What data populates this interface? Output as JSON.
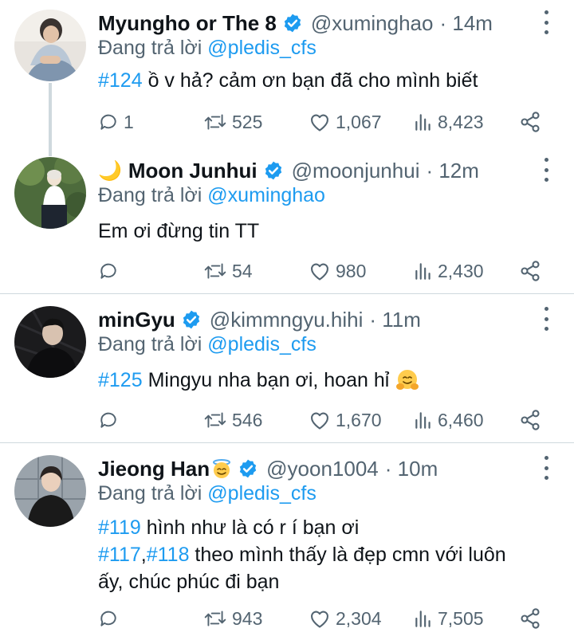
{
  "colors": {
    "accent": "#1d9bf0",
    "secondary_text": "#536471",
    "primary_text": "#0f1419",
    "divider": "#cfd9de"
  },
  "tweets": [
    {
      "name": "Myungho or The 8",
      "name_prefix_emoji": "",
      "name_suffix_emoji": "",
      "handle": "@xuminghao",
      "time": "· 14m",
      "reply_prefix": "Đang trả lời ",
      "reply_to": "@pledis_cfs",
      "lines": [
        {
          "tag": "#124",
          "text": " ồ v hả? cảm ơn bạn đã cho mình biết"
        }
      ],
      "replies": "1",
      "retweets": "525",
      "likes": "1,067",
      "views": "8,423"
    },
    {
      "name": "Moon Junhui",
      "name_prefix_emoji": "🌙",
      "handle": "@moonjunhui",
      "time": "· 12m",
      "reply_prefix": "Đang trả lời ",
      "reply_to": "@xuminghao",
      "lines": [
        {
          "tag": "",
          "text": "Em ơi đừng tin TT"
        }
      ],
      "replies": "",
      "retweets": "54",
      "likes": "980",
      "views": "2,430"
    },
    {
      "name": "minGyu",
      "handle": "@kimmngyu.hihi",
      "time": "· 11m",
      "reply_prefix": "Đang trả lời ",
      "reply_to": "@pledis_cfs",
      "lines": [
        {
          "tag": "#125",
          "text": " Mingyu nha bạn ơi, hoan hỉ",
          "emoji": "hugging-face"
        }
      ],
      "replies": "",
      "retweets": "546",
      "likes": "1,670",
      "views": "6,460"
    },
    {
      "name": "Jieong Han",
      "name_suffix_emoji": "smiling-face-with-halo",
      "handle": "@yoon1004",
      "time": "· 10m",
      "reply_prefix": "Đang trả lời ",
      "reply_to": "@pledis_cfs",
      "lines": [
        {
          "tag": "#119",
          "text": " hình như là có r í bạn ơi"
        },
        {
          "tag": "#117",
          "sep": ",",
          "tag2": "#118",
          "text": " theo mình thấy là đẹp cmn với luôn"
        },
        {
          "tag": "",
          "text": "ấy, chúc phúc đi bạn"
        }
      ],
      "replies": "",
      "retweets": "943",
      "likes": "2,304",
      "views": "7,505"
    }
  ]
}
